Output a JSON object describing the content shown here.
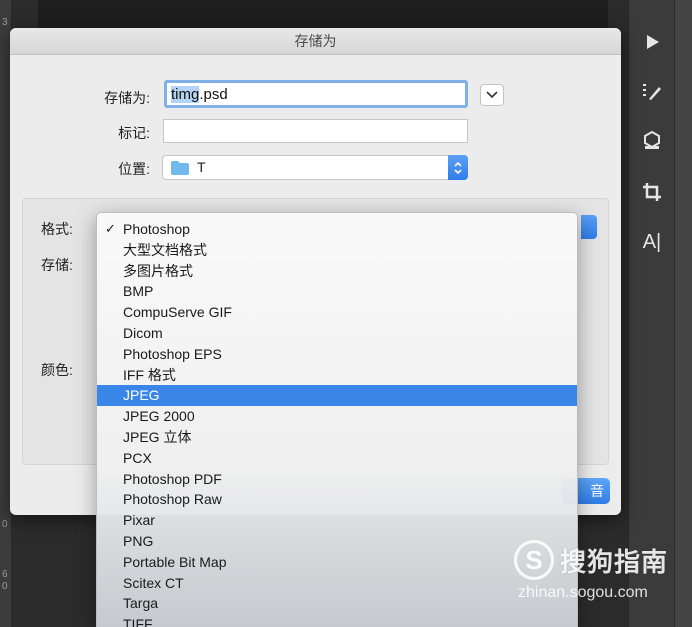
{
  "dialog": {
    "title": "存储为",
    "save_as_label": "存储为:",
    "filename_selected": "timg",
    "filename_rest": ".psd",
    "tags_label": "标记:",
    "tags_value": "",
    "where_label": "位置:",
    "where_value": "T",
    "save_button_fragment": "音"
  },
  "options": {
    "format_label": "格式:",
    "save_label": "存储:",
    "color_label": "颜色:"
  },
  "format_menu": {
    "items": [
      {
        "label": "Photoshop",
        "checked": true
      },
      {
        "label": "大型文档格式"
      },
      {
        "label": "多图片格式"
      },
      {
        "label": "BMP"
      },
      {
        "label": "CompuServe GIF"
      },
      {
        "label": "Dicom"
      },
      {
        "label": "Photoshop EPS"
      },
      {
        "label": "IFF 格式"
      },
      {
        "label": "JPEG",
        "highlighted": true
      },
      {
        "label": "JPEG 2000"
      },
      {
        "label": "JPEG 立体"
      },
      {
        "label": "PCX"
      },
      {
        "label": "Photoshop PDF"
      },
      {
        "label": "Photoshop Raw"
      },
      {
        "label": "Pixar"
      },
      {
        "label": "PNG"
      },
      {
        "label": "Portable Bit Map"
      },
      {
        "label": "Scitex CT"
      },
      {
        "label": "Targa"
      },
      {
        "label": "TIFF"
      }
    ],
    "check_mark": "✓"
  },
  "ruler": {
    "numbers": [
      "3",
      "0",
      "6",
      "0"
    ]
  },
  "tools": {
    "type_tool_label": "A|"
  },
  "watermark": {
    "logo": "S",
    "text": "搜狗指南",
    "url": "zhinan.sogou.com"
  },
  "colors": {
    "accent": "#3a86e8",
    "highlight": "#3a86e8",
    "focus_ring": "#7fb0e8"
  }
}
